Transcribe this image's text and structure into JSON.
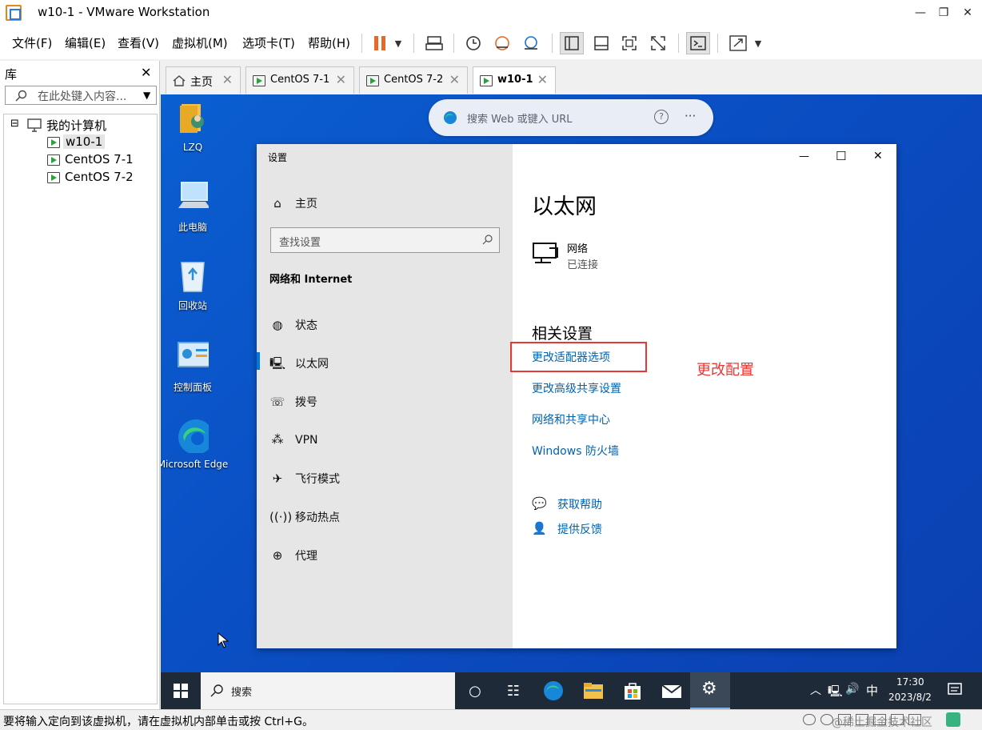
{
  "window": {
    "title": "w10-1 - VMware Workstation",
    "minimize": "—",
    "restore": "❐",
    "close": "✕"
  },
  "menu": [
    "文件(F)",
    "编辑(E)",
    "查看(V)",
    "虚拟机(M)",
    "选项卡(T)",
    "帮助(H)"
  ],
  "library": {
    "title": "库",
    "close": "✕",
    "search_placeholder": "在此处键入内容...",
    "root": "我的计算机",
    "expander": "⊟",
    "vms": [
      "w10-1",
      "CentOS 7-1",
      "CentOS 7-2"
    ]
  },
  "tabs": [
    {
      "label": "主页",
      "close": "✕"
    },
    {
      "label": "CentOS 7-1",
      "close": "✕"
    },
    {
      "label": "CentOS 7-2",
      "close": "✕"
    },
    {
      "label": "w10-1",
      "close": "✕"
    }
  ],
  "desktop_icons": [
    "LZQ",
    "此电脑",
    "回收站",
    "控制面板",
    "Microsoft Edge"
  ],
  "edge_bar": {
    "placeholder": "搜索 Web 或键入 URL",
    "help": "?",
    "more": "···"
  },
  "settings": {
    "window_title": "设置",
    "minimize": "—",
    "maximize": "☐",
    "close": "✕",
    "home": "主页",
    "search_placeholder": "查找设置",
    "section": "网络和 Internet",
    "nav": [
      "状态",
      "以太网",
      "拨号",
      "VPN",
      "飞行模式",
      "移动热点",
      "代理"
    ],
    "page_title": "以太网",
    "network_name": "网络",
    "network_status": "已连接",
    "related_title": "相关设置",
    "links": [
      "更改适配器选项",
      "更改高级共享设置",
      "网络和共享中心",
      "Windows 防火墙"
    ],
    "help": [
      "获取帮助",
      "提供反馈"
    ]
  },
  "annotation": {
    "label": "更改配置",
    "color": "#e53935"
  },
  "taskbar": {
    "search_placeholder": "搜索",
    "ime": "中",
    "time": "17:30",
    "date": "2023/8/2"
  },
  "statusbar": {
    "text": "要将输入定向到该虚拟机，请在虚拟机内部单击或按 Ctrl+G。"
  },
  "watermark": "@稀土掘金技术社区",
  "colors": {
    "accent": "#0078d7",
    "link": "#0063b1",
    "vmware_pause": "#e8682a",
    "annotation": "#e53935"
  }
}
